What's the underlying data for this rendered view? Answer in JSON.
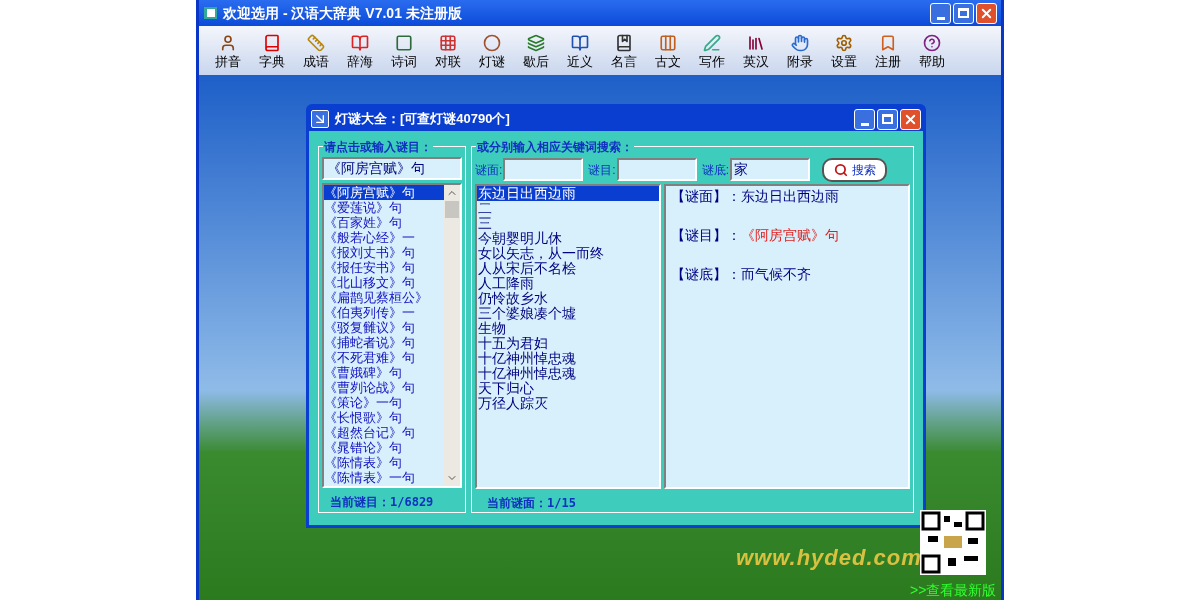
{
  "window": {
    "title": "欢迎选用 - 汉语大辞典 V7.01 未注册版"
  },
  "toolbar": {
    "items": [
      {
        "label": "拼音"
      },
      {
        "label": "字典"
      },
      {
        "label": "成语"
      },
      {
        "label": "辞海"
      },
      {
        "label": "诗词"
      },
      {
        "label": "对联"
      },
      {
        "label": "灯谜"
      },
      {
        "label": "歇后"
      },
      {
        "label": "近义"
      },
      {
        "label": "名言"
      },
      {
        "label": "古文"
      },
      {
        "label": "写作"
      },
      {
        "label": "英汉"
      },
      {
        "label": "附录"
      },
      {
        "label": "设置"
      },
      {
        "label": "注册"
      },
      {
        "label": "帮助"
      }
    ]
  },
  "dialog": {
    "title": "灯谜大全：[可查灯谜40790个]",
    "left_group": {
      "legend": "请点击或输入谜目：",
      "input_value": "《阿房宫赋》句",
      "status": "当前谜目：1/6829",
      "items": [
        {
          "text": "《阿房宫赋》句",
          "selected": true
        },
        {
          "text": "《爱莲说》句",
          "selected": false
        },
        {
          "text": "《百家姓》句",
          "selected": false
        },
        {
          "text": "《般若心经》一",
          "selected": false
        },
        {
          "text": "《报刘丈书》句",
          "selected": false
        },
        {
          "text": "《报任安书》句",
          "selected": false
        },
        {
          "text": "《北山移文》句",
          "selected": false
        },
        {
          "text": "《扁鹊见蔡桓公》",
          "selected": false
        },
        {
          "text": "《伯夷列传》一",
          "selected": false
        },
        {
          "text": "《驳复雠议》句",
          "selected": false
        },
        {
          "text": "《捕蛇者说》句",
          "selected": false
        },
        {
          "text": "《不死君难》句",
          "selected": false
        },
        {
          "text": "《曹娥碑》句",
          "selected": false
        },
        {
          "text": "《曹刿论战》句",
          "selected": false
        },
        {
          "text": "《策论》一句",
          "selected": false
        },
        {
          "text": "《长恨歌》句",
          "selected": false
        },
        {
          "text": "《超然台记》句",
          "selected": false
        },
        {
          "text": "《晁错论》句",
          "selected": false
        },
        {
          "text": "《陈情表》句",
          "selected": false
        },
        {
          "text": "《陈情表》一句",
          "selected": false
        }
      ]
    },
    "right_group": {
      "legend": "或分别输入相应关键词搜索：",
      "fields": [
        {
          "label": "谜面:"
        },
        {
          "label": "谜目:"
        },
        {
          "label": "谜底:",
          "value": "家"
        }
      ],
      "search_button": "搜索",
      "status": "当前谜面：1/15",
      "results": [
        {
          "text": "东边日出西边雨",
          "selected": true
        },
        {
          "text": "二",
          "selected": false
        },
        {
          "text": "三",
          "selected": false
        },
        {
          "text": "今朝婴明儿休",
          "selected": false
        },
        {
          "text": "女以矢志，从一而终",
          "selected": false
        },
        {
          "text": "人从宋后不名桧",
          "selected": false
        },
        {
          "text": "人工降雨",
          "selected": false
        },
        {
          "text": "仍怜故乡水",
          "selected": false
        },
        {
          "text": "三个婆娘凑个墟",
          "selected": false
        },
        {
          "text": "生物",
          "selected": false
        },
        {
          "text": "十五为君妇",
          "selected": false
        },
        {
          "text": "十亿神州悼忠魂",
          "selected": false
        },
        {
          "text": "十亿神州悼忠魂",
          "selected": false
        },
        {
          "text": "天下归心",
          "selected": false
        },
        {
          "text": "万径人踪灭",
          "selected": false
        }
      ],
      "detail": [
        {
          "label": "【谜面】：",
          "value": "东边日出西边雨",
          "color": "#000080"
        },
        {
          "label": "【谜目】：",
          "value": "《阿房宫赋》句",
          "color": "#e02020"
        },
        {
          "label": "【谜底】：",
          "value": "而气候不齐",
          "color": "#000080"
        }
      ]
    }
  },
  "desktop": {
    "website": "www.hyded.com",
    "latest_link": ">>查看最新版"
  }
}
